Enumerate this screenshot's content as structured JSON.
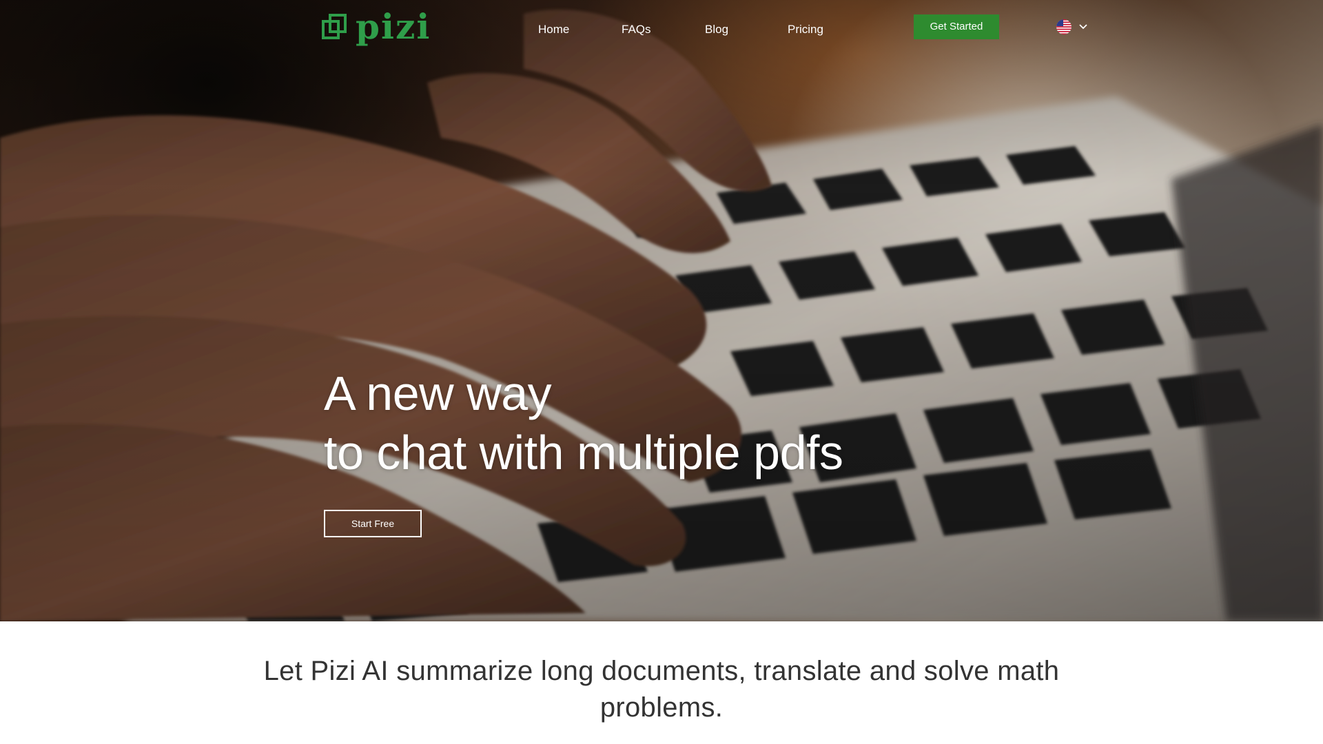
{
  "brand": {
    "name": "pizi",
    "color": "#2f9e4a"
  },
  "nav": {
    "items": [
      {
        "label": "Home"
      },
      {
        "label": "FAQs"
      },
      {
        "label": "Blog"
      },
      {
        "label": "Pricing"
      }
    ]
  },
  "header": {
    "cta_label": "Get Started",
    "cta_color": "#2e8b2f",
    "language_icon": "us-flag-icon",
    "dropdown_icon": "chevron-down-icon"
  },
  "hero": {
    "headline_line1": "A new way",
    "headline_line2": "to chat with multiple pdfs",
    "cta_label": "Start Free",
    "image": "hands-typing-on-laptop-keyboard"
  },
  "intro": {
    "text": "Let Pizi AI summarize long documents, translate and solve math problems."
  }
}
